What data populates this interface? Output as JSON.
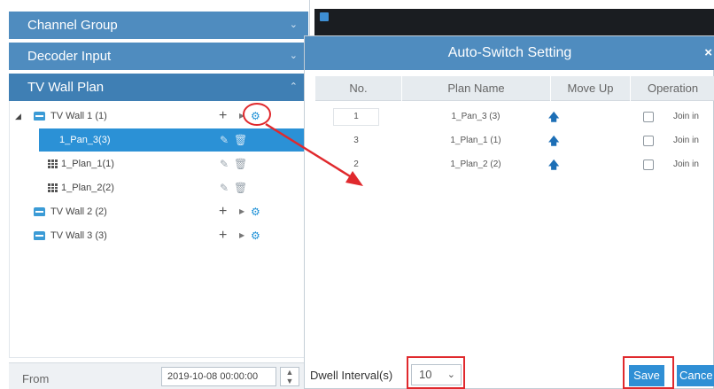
{
  "sidebar": {
    "sections": [
      {
        "label": "Channel Group",
        "chevron": "chevron-down-icon"
      },
      {
        "label": "Decoder Input",
        "chevron": "chevron-down-icon"
      },
      {
        "label": "TV Wall Plan",
        "chevron": "chevron-up-icon"
      }
    ],
    "tree": [
      {
        "label": "TV Wall 1 (1)",
        "type": "wall",
        "expanded": true
      },
      {
        "label": "1_Pan_3(3)",
        "type": "plan",
        "selected": true
      },
      {
        "label": "1_Plan_1(1)",
        "type": "plan"
      },
      {
        "label": "1_Plan_2(2)",
        "type": "plan"
      },
      {
        "label": "TV Wall 2 (2)",
        "type": "wall"
      },
      {
        "label": "TV Wall 3 (3)",
        "type": "wall"
      }
    ],
    "from_label": "From",
    "from_value": "2019-10-08 00:00:00"
  },
  "dialog": {
    "title": "Auto-Switch Setting",
    "columns": [
      "No.",
      "Plan Name",
      "Move Up",
      "Operation"
    ],
    "rows": [
      {
        "no": "1",
        "plan": "1_Pan_3 (3)",
        "join": "Join in",
        "checked": false
      },
      {
        "no": "3",
        "plan": "1_Plan_1 (1)",
        "join": "Join in",
        "checked": false
      },
      {
        "no": "2",
        "plan": "1_Plan_2 (2)",
        "join": "Join in",
        "checked": false
      }
    ],
    "dwell_label": "Dwell Interval(s)",
    "dwell_value": "10",
    "save_label": "Save",
    "cancel_label": "Cance"
  },
  "colors": {
    "header_blue": "#4f8cbf",
    "selection_blue": "#2b91d6",
    "annotation_red": "#e0292d"
  }
}
